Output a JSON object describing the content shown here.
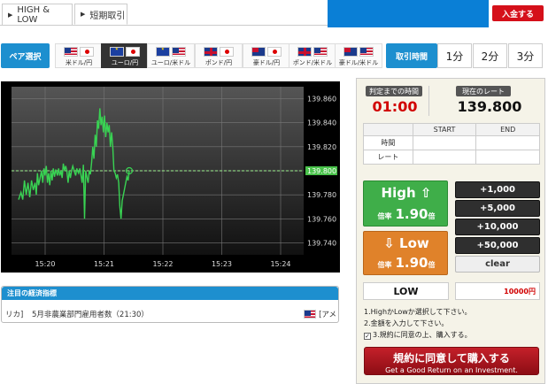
{
  "header": {
    "tabs": [
      {
        "label": "HIGH & LOW",
        "active": false
      },
      {
        "label": "短期取引",
        "active": true
      }
    ],
    "deposit_label": "入金する"
  },
  "pairs": {
    "label": "ペア選択",
    "items": [
      {
        "label": "米ドル/円",
        "flags": [
          "us",
          "jp"
        ],
        "selected": false
      },
      {
        "label": "ユーロ/円",
        "flags": [
          "eu",
          "jp"
        ],
        "selected": true
      },
      {
        "label": "ユーロ/米ドル",
        "flags": [
          "eu",
          "us"
        ],
        "selected": false
      },
      {
        "label": "ポンド/円",
        "flags": [
          "gb",
          "jp"
        ],
        "selected": false
      },
      {
        "label": "豪ドル/円",
        "flags": [
          "au",
          "jp"
        ],
        "selected": false
      },
      {
        "label": "ポンド/米ドル",
        "flags": [
          "gb",
          "us"
        ],
        "selected": false
      },
      {
        "label": "豪ドル/米ドル",
        "flags": [
          "au",
          "us"
        ],
        "selected": false
      }
    ]
  },
  "trade_time": {
    "label": "取引時間",
    "options": [
      {
        "label": "1分",
        "selected": true
      },
      {
        "label": "2分",
        "selected": false
      },
      {
        "label": "3分",
        "selected": false
      }
    ]
  },
  "chart_data": {
    "type": "line",
    "x_ticks": [
      "15:20",
      "15:21",
      "15:22",
      "15:23",
      "15:24"
    ],
    "y_ticks": [
      "139.860",
      "139.840",
      "139.820",
      "139.800",
      "139.780",
      "139.760",
      "139.740"
    ],
    "ylim": [
      139.73,
      139.87
    ],
    "current_rate_label": "139.800",
    "current_rate": 139.8,
    "line_color": "#39d353",
    "series": [
      {
        "values": [
          [
            0.0,
            139.776
          ],
          [
            0.04,
            139.782
          ],
          [
            0.07,
            139.776
          ],
          [
            0.1,
            139.792
          ],
          [
            0.13,
            139.78
          ],
          [
            0.16,
            139.79
          ],
          [
            0.19,
            139.778
          ],
          [
            0.22,
            139.792
          ],
          [
            0.25,
            139.784
          ],
          [
            0.28,
            139.79
          ],
          [
            0.3,
            139.78
          ],
          [
            0.32,
            139.798
          ],
          [
            0.34,
            139.788
          ],
          [
            0.37,
            139.795
          ],
          [
            0.39,
            139.8
          ],
          [
            0.41,
            139.79
          ],
          [
            0.43,
            139.802
          ],
          [
            0.45,
            139.796
          ],
          [
            0.47,
            139.804
          ],
          [
            0.49,
            139.79
          ],
          [
            0.51,
            139.798
          ],
          [
            0.53,
            139.788
          ],
          [
            0.55,
            139.8
          ],
          [
            0.57,
            139.792
          ],
          [
            0.59,
            139.802
          ],
          [
            0.61,
            139.795
          ],
          [
            0.63,
            139.801
          ],
          [
            0.66,
            139.796
          ],
          [
            0.68,
            139.802
          ],
          [
            0.7,
            139.796
          ],
          [
            0.72,
            139.8
          ],
          [
            0.74,
            139.794
          ],
          [
            0.76,
            139.806
          ],
          [
            0.78,
            139.8
          ],
          [
            0.8,
            139.804
          ],
          [
            0.82,
            139.8
          ],
          [
            0.84,
            139.79
          ],
          [
            0.86,
            139.8
          ],
          [
            0.88,
            139.794
          ],
          [
            0.9,
            139.8
          ],
          [
            0.92,
            139.804
          ],
          [
            0.95,
            139.799
          ],
          [
            0.97,
            139.796
          ],
          [
            0.99,
            139.802
          ],
          [
            1.0,
            139.8
          ],
          [
            1.02,
            139.798
          ],
          [
            1.04,
            139.802
          ],
          [
            1.06,
            139.796
          ],
          [
            1.08,
            139.79
          ],
          [
            1.1,
            139.805
          ],
          [
            1.12,
            139.76
          ],
          [
            1.14,
            139.8
          ],
          [
            1.16,
            139.795
          ],
          [
            1.18,
            139.79
          ],
          [
            1.2,
            139.8
          ],
          [
            1.22,
            139.797
          ],
          [
            1.24,
            139.807
          ],
          [
            1.26,
            139.82
          ],
          [
            1.28,
            139.81
          ],
          [
            1.3,
            139.83
          ],
          [
            1.32,
            139.82
          ],
          [
            1.34,
            139.842
          ],
          [
            1.36,
            139.835
          ],
          [
            1.38,
            139.852
          ],
          [
            1.4,
            139.838
          ],
          [
            1.42,
            139.845
          ],
          [
            1.44,
            139.832
          ],
          [
            1.46,
            139.846
          ],
          [
            1.48,
            139.828
          ],
          [
            1.5,
            139.84
          ],
          [
            1.52,
            139.832
          ],
          [
            1.54,
            139.838
          ],
          [
            1.56,
            139.82
          ],
          [
            1.58,
            139.832
          ],
          [
            1.6,
            139.82
          ],
          [
            1.62,
            139.8
          ],
          [
            1.64,
            139.798
          ],
          [
            1.66,
            139.794
          ],
          [
            1.68,
            139.797
          ],
          [
            1.7,
            139.79
          ],
          [
            1.72,
            139.77
          ],
          [
            1.74,
            139.76
          ],
          [
            1.76,
            139.775
          ],
          [
            1.78,
            139.78
          ],
          [
            1.8,
            139.785
          ],
          [
            1.82,
            139.79
          ],
          [
            1.84,
            139.795
          ],
          [
            1.86,
            139.792
          ],
          [
            1.88,
            139.8
          ]
        ]
      }
    ]
  },
  "economic": {
    "header": "注目の経済指標",
    "country": "リカ]",
    "title": "5月非農業部門雇用者数（21:30）",
    "right_text": "[アメ"
  },
  "panel": {
    "countdown_label": "判定までの時間",
    "countdown": "01:00",
    "rate_label": "現在のレート",
    "rate": "139.800",
    "table": {
      "headers": [
        "",
        "START",
        "END"
      ],
      "rows": [
        {
          "label": "時間",
          "start": "",
          "end": ""
        },
        {
          "label": "レート",
          "start": "",
          "end": ""
        }
      ]
    },
    "high": {
      "label": "High",
      "arrow": "⇧",
      "payout_label": "倍率",
      "payout": "1.90",
      "unit": "倍"
    },
    "low": {
      "label": "Low",
      "arrow": "⇩",
      "payout_label": "倍率",
      "payout": "1.90",
      "unit": "倍"
    },
    "amounts": [
      "+1,000",
      "+5,000",
      "+10,000",
      "+50,000"
    ],
    "clear_label": "clear",
    "selection": "LOW",
    "amount_value": "10000円",
    "instructions": [
      "1.HighかLowか選択して下さい。",
      "2.金額を入力して下さい。",
      "3.規約に同意の上、購入する。"
    ],
    "agree_checked": true,
    "buy_title": "規約に同意して購入する",
    "buy_subtitle": "Get a Good Return on an Investment."
  }
}
